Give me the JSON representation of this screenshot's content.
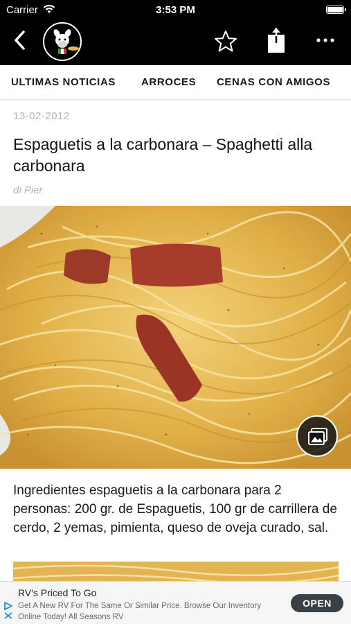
{
  "status_bar": {
    "carrier": "Carrier",
    "time": "3:53 PM"
  },
  "nav": {
    "icons": [
      "back-chevron-icon",
      "chef-logo",
      "star-icon",
      "share-icon",
      "more-icon"
    ]
  },
  "tabs": [
    {
      "label": "ULTIMAS NOTICIAS"
    },
    {
      "label": "ARROCES"
    },
    {
      "label": "CENAS CON AMIGOS"
    }
  ],
  "article": {
    "date": "13-02-2012",
    "title": "Espaguetis a la carbonara – Spaghetti alla carbonara",
    "author": "di Pier",
    "body": "Ingredientes espaguetis a la carbonara para 2 personas: 200 gr. de Espaguetis, 100 gr de carrillera de cerdo, 2 yemas, pimienta, queso de oveja curado, sal."
  },
  "ad": {
    "title": "RV's Priced To Go",
    "description": "Get A New RV For The Same Or Similar Price. Browse Our Inventory Online Today! All Seasons RV",
    "cta": "OPEN"
  },
  "colors": {
    "topbar": "#000000",
    "tab_text": "#1a1a1a",
    "meta_text": "#b5b5b5",
    "ad_button": "#3a4048"
  }
}
